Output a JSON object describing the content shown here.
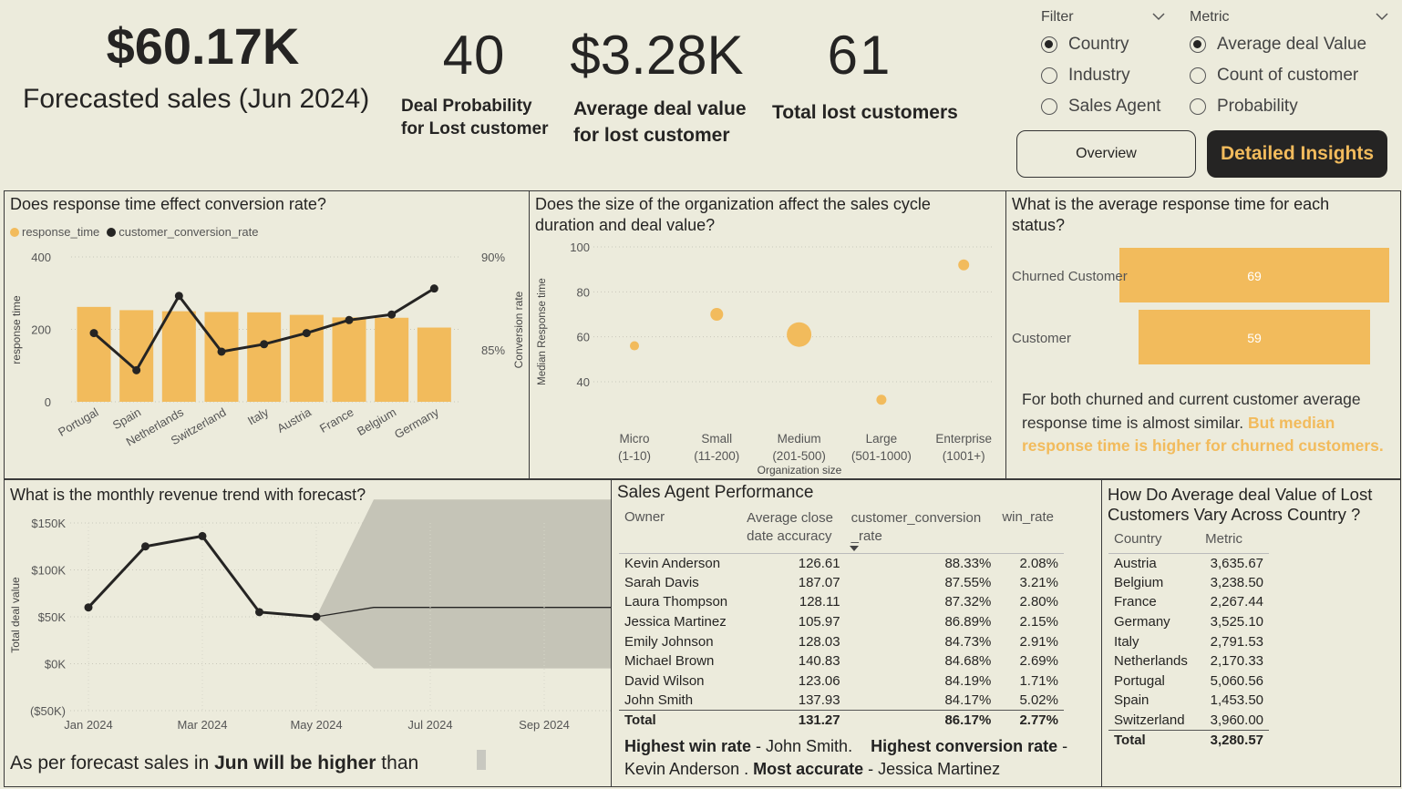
{
  "kpis": {
    "forecast_value": "$60.17K",
    "forecast_label": "Forecasted sales (Jun 2024)",
    "deal_prob_value": "40",
    "deal_prob_label_1": "Deal Probability",
    "deal_prob_label_2": "for Lost customer",
    "avg_deal_value": "$3.28K",
    "avg_deal_label_1": "Average deal value",
    "avg_deal_label_2": "for lost customer",
    "lost_value": "61",
    "lost_label": "Total lost customers"
  },
  "filter": {
    "title": "Filter",
    "options": [
      "Country",
      "Industry",
      "Sales Agent"
    ],
    "selected": "Country"
  },
  "metric": {
    "title": "Metric",
    "options": [
      "Average deal Value",
      "Count of customer",
      "Probability"
    ],
    "selected": "Average deal Value"
  },
  "nav": {
    "overview_label": "Overview",
    "detailed_label": "Detailed Insights"
  },
  "colors": {
    "accent": "#f2bb5c",
    "dark": "#252423",
    "background": "#ecebdc",
    "forecast_band": "#c5c4b7"
  },
  "panel1": {
    "title": "Does response time effect conversion rate?",
    "legend": [
      "response_time",
      "customer_conversion_rate"
    ]
  },
  "panel2": {
    "title_1": "Does the size of the organization affect the sales cycle",
    "title_2": "duration and deal value?"
  },
  "panel3": {
    "title_1": "What is the average response time for each",
    "title_2": "status?",
    "note_plain": "For both churned and current customer average response time is almost similar.",
    "note_highlight": "But median response time is higher for churned customers."
  },
  "panel4": {
    "title": "What is the monthly revenue trend with forecast?",
    "note_a": "As per forecast sales in ",
    "note_b": "Jun will be higher",
    "note_c": " than"
  },
  "sales_agent": {
    "title": "Sales Agent Performance",
    "headers": [
      "Owner",
      "Average close date accuracy",
      "customer_conversion_rate",
      "win_rate"
    ],
    "header_lines": {
      "col2_a": "Average close",
      "col2_b": "date accuracy",
      "col3_a": "customer_conversion",
      "col3_b": "_rate"
    },
    "rows": [
      [
        "Kevin Anderson",
        "126.61",
        "88.33%",
        "2.08%"
      ],
      [
        "Sarah Davis",
        "187.07",
        "87.55%",
        "3.21%"
      ],
      [
        "Laura Thompson",
        "128.11",
        "87.32%",
        "2.80%"
      ],
      [
        "Jessica Martinez",
        "105.97",
        "86.89%",
        "2.15%"
      ],
      [
        "Emily Johnson",
        "128.03",
        "84.73%",
        "2.91%"
      ],
      [
        "Michael Brown",
        "140.83",
        "84.68%",
        "2.69%"
      ],
      [
        "David Wilson",
        "123.06",
        "84.19%",
        "1.71%"
      ],
      [
        "John Smith",
        "137.93",
        "84.17%",
        "5.02%"
      ]
    ],
    "total": [
      "Total",
      "131.27",
      "86.17%",
      "2.77%"
    ],
    "insight": {
      "b1": "Highest win rate",
      "t1": " - John Smith. ",
      "b2": "Highest conversion rate",
      "t2": " - Kevin Anderson . ",
      "b3": "Most accurate",
      "t3": " - Jessica Martinez"
    }
  },
  "country_table": {
    "title_1": "How Do Average deal Value of Lost",
    "title_2": "Customers Vary Across Country ?",
    "headers": [
      "Country",
      "Metric"
    ],
    "rows": [
      [
        "Austria",
        "3,635.67"
      ],
      [
        "Belgium",
        "3,238.50"
      ],
      [
        "France",
        "2,267.44"
      ],
      [
        "Germany",
        "3,525.10"
      ],
      [
        "Italy",
        "2,791.53"
      ],
      [
        "Netherlands",
        "2,170.33"
      ],
      [
        "Portugal",
        "5,060.56"
      ],
      [
        "Spain",
        "1,453.50"
      ],
      [
        "Switzerland",
        "3,960.00"
      ]
    ],
    "total": [
      "Total",
      "3,280.57"
    ]
  },
  "chart_data": [
    {
      "type": "bar",
      "id": "response_vs_conversion",
      "categories": [
        "Portugal",
        "Spain",
        "Netherlands",
        "Switzerland",
        "Italy",
        "Austria",
        "France",
        "Belgium",
        "Germany"
      ],
      "series": [
        {
          "name": "response_time",
          "kind": "bar",
          "axis": "left",
          "values": [
            262,
            253,
            250,
            248,
            247,
            240,
            233,
            232,
            205
          ]
        },
        {
          "name": "customer_conversion_rate",
          "kind": "line",
          "axis": "right",
          "values": [
            85.9,
            83.9,
            87.9,
            84.9,
            85.3,
            85.9,
            86.6,
            86.9,
            88.3
          ]
        }
      ],
      "ylabel": "response time",
      "y2label": "Conversion rate",
      "ylim": [
        0,
        400
      ],
      "yticks": [
        "400",
        "200",
        "0"
      ],
      "y2lim": [
        82.2,
        90
      ],
      "y2ticks": [
        "90%",
        "85%"
      ],
      "legend": "top-left",
      "grid": true
    },
    {
      "type": "scatter",
      "id": "org_size",
      "categories": [
        "Micro (1-10)",
        "Small (11-200)",
        "Medium (201-500)",
        "Large (501-1000)",
        "Enterprise (1001+)"
      ],
      "cat_lines": [
        [
          "Micro",
          "(1-10)"
        ],
        [
          "Small",
          "(11-200)"
        ],
        [
          "Medium",
          "(201-500)"
        ],
        [
          "Large",
          "(501-1000)"
        ],
        [
          "Enterprise",
          "(1001+)"
        ]
      ],
      "values": [
        56,
        70,
        61,
        32,
        92
      ],
      "sizes": [
        1,
        1.4,
        2.7,
        1.1,
        1.2
      ],
      "xlabel": "Organization size",
      "ylabel": "Median Response time",
      "ylim": [
        25,
        100
      ],
      "yticks": [
        "100",
        "80",
        "60",
        "40"
      ],
      "grid": true
    },
    {
      "type": "bar",
      "id": "avg_response_status",
      "orientation": "horizontal",
      "categories": [
        "Churned Customer",
        "Customer"
      ],
      "values": [
        69,
        59
      ],
      "data_labels": [
        "69",
        "59"
      ]
    },
    {
      "type": "line",
      "id": "monthly_revenue",
      "x": [
        "Jan 2024",
        "Feb 2024",
        "Mar 2024",
        "Apr 2024",
        "May 2024"
      ],
      "values": [
        60,
        125,
        136,
        55,
        50
      ],
      "forecast": {
        "start": "May 2024",
        "end": "Oct 2024",
        "value": 60,
        "upper": 175,
        "lower": -5
      },
      "xticks": [
        "Jan 2024",
        "Mar 2024",
        "May 2024",
        "Jul 2024",
        "Sep 2024"
      ],
      "yticks": [
        "$150K",
        "$100K",
        "$50K",
        "$0K",
        "($50K)"
      ],
      "ylim": [
        -50,
        150
      ],
      "ylabel": "Total deal value",
      "grid": true
    }
  ]
}
